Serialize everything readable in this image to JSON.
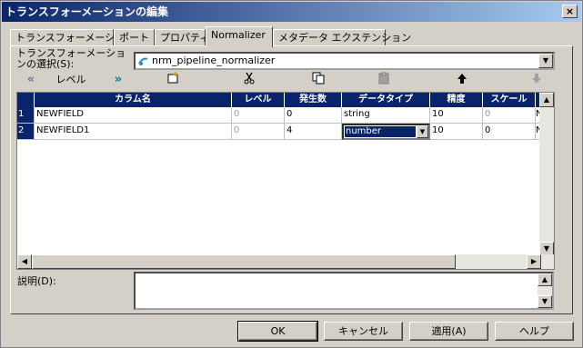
{
  "window": {
    "title": "トランスフォーメーションの編集",
    "close_glyph": "×"
  },
  "tabs": [
    {
      "label": "トランスフォーメーション"
    },
    {
      "label": "ポート"
    },
    {
      "label": "プロパティ"
    },
    {
      "label": "Normalizer"
    },
    {
      "label": "メタデータ エクステンション"
    }
  ],
  "selector": {
    "label": "トランスフォーメーションの選択(S):",
    "value": "nrm_pipeline_normalizer"
  },
  "toolbar": {
    "level_label": "レベル"
  },
  "grid": {
    "headers": [
      "カラム名",
      "レベル",
      "発生数",
      "データタイプ",
      "精度",
      "スケール"
    ],
    "rows": [
      {
        "num": "1",
        "name": "NEWFIELD",
        "level": "0",
        "occurs": "0",
        "datatype": "string",
        "precision": "10",
        "scale": "0",
        "extra": "N"
      },
      {
        "num": "2",
        "name": "NEWFIELD1",
        "level": "0",
        "occurs": "4",
        "datatype": "number",
        "precision": "10",
        "scale": "0",
        "extra": "N"
      }
    ]
  },
  "description": {
    "label": "説明(D):",
    "value": ""
  },
  "buttons": {
    "ok": "OK",
    "cancel": "キャンセル",
    "apply": "適用(A)",
    "help": "ヘルプ"
  }
}
